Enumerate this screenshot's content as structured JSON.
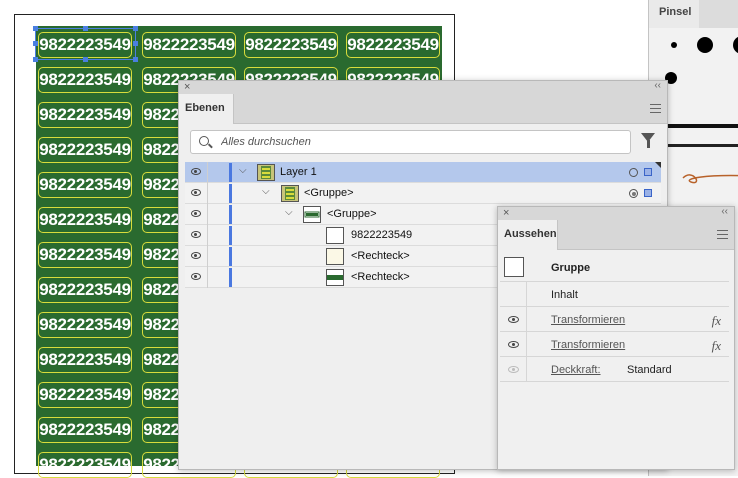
{
  "artboard": {
    "label_text": "9822223549",
    "background_color": "#2a6a2f",
    "label_border_color": "#d8dc3c",
    "selection_color": "#4a7fe0"
  },
  "brush_panel": {
    "tab": "Pinsel"
  },
  "layers_panel": {
    "tab": "Ebenen",
    "search": {
      "placeholder": "Alles durchsuchen",
      "value": ""
    },
    "rows": [
      {
        "name": "Layer 1",
        "selected": true
      },
      {
        "name": "<Gruppe>"
      },
      {
        "name": "<Gruppe>"
      },
      {
        "name": "9822223549"
      },
      {
        "name": "<Rechteck>"
      },
      {
        "name": "<Rechteck>"
      }
    ]
  },
  "appearance_panel": {
    "tab": "Aussehen",
    "object_type": "Gruppe",
    "content": "Inhalt",
    "effects": [
      {
        "label": "Transformieren",
        "icon": "fx-icon"
      },
      {
        "label": "Transformieren",
        "icon": "fx-icon"
      }
    ],
    "opacity": {
      "label": "Deckkraft:",
      "value": "Standard"
    }
  },
  "colors": {
    "layer_color": "#4a78e0",
    "selected_row": "#b4c8ec"
  }
}
